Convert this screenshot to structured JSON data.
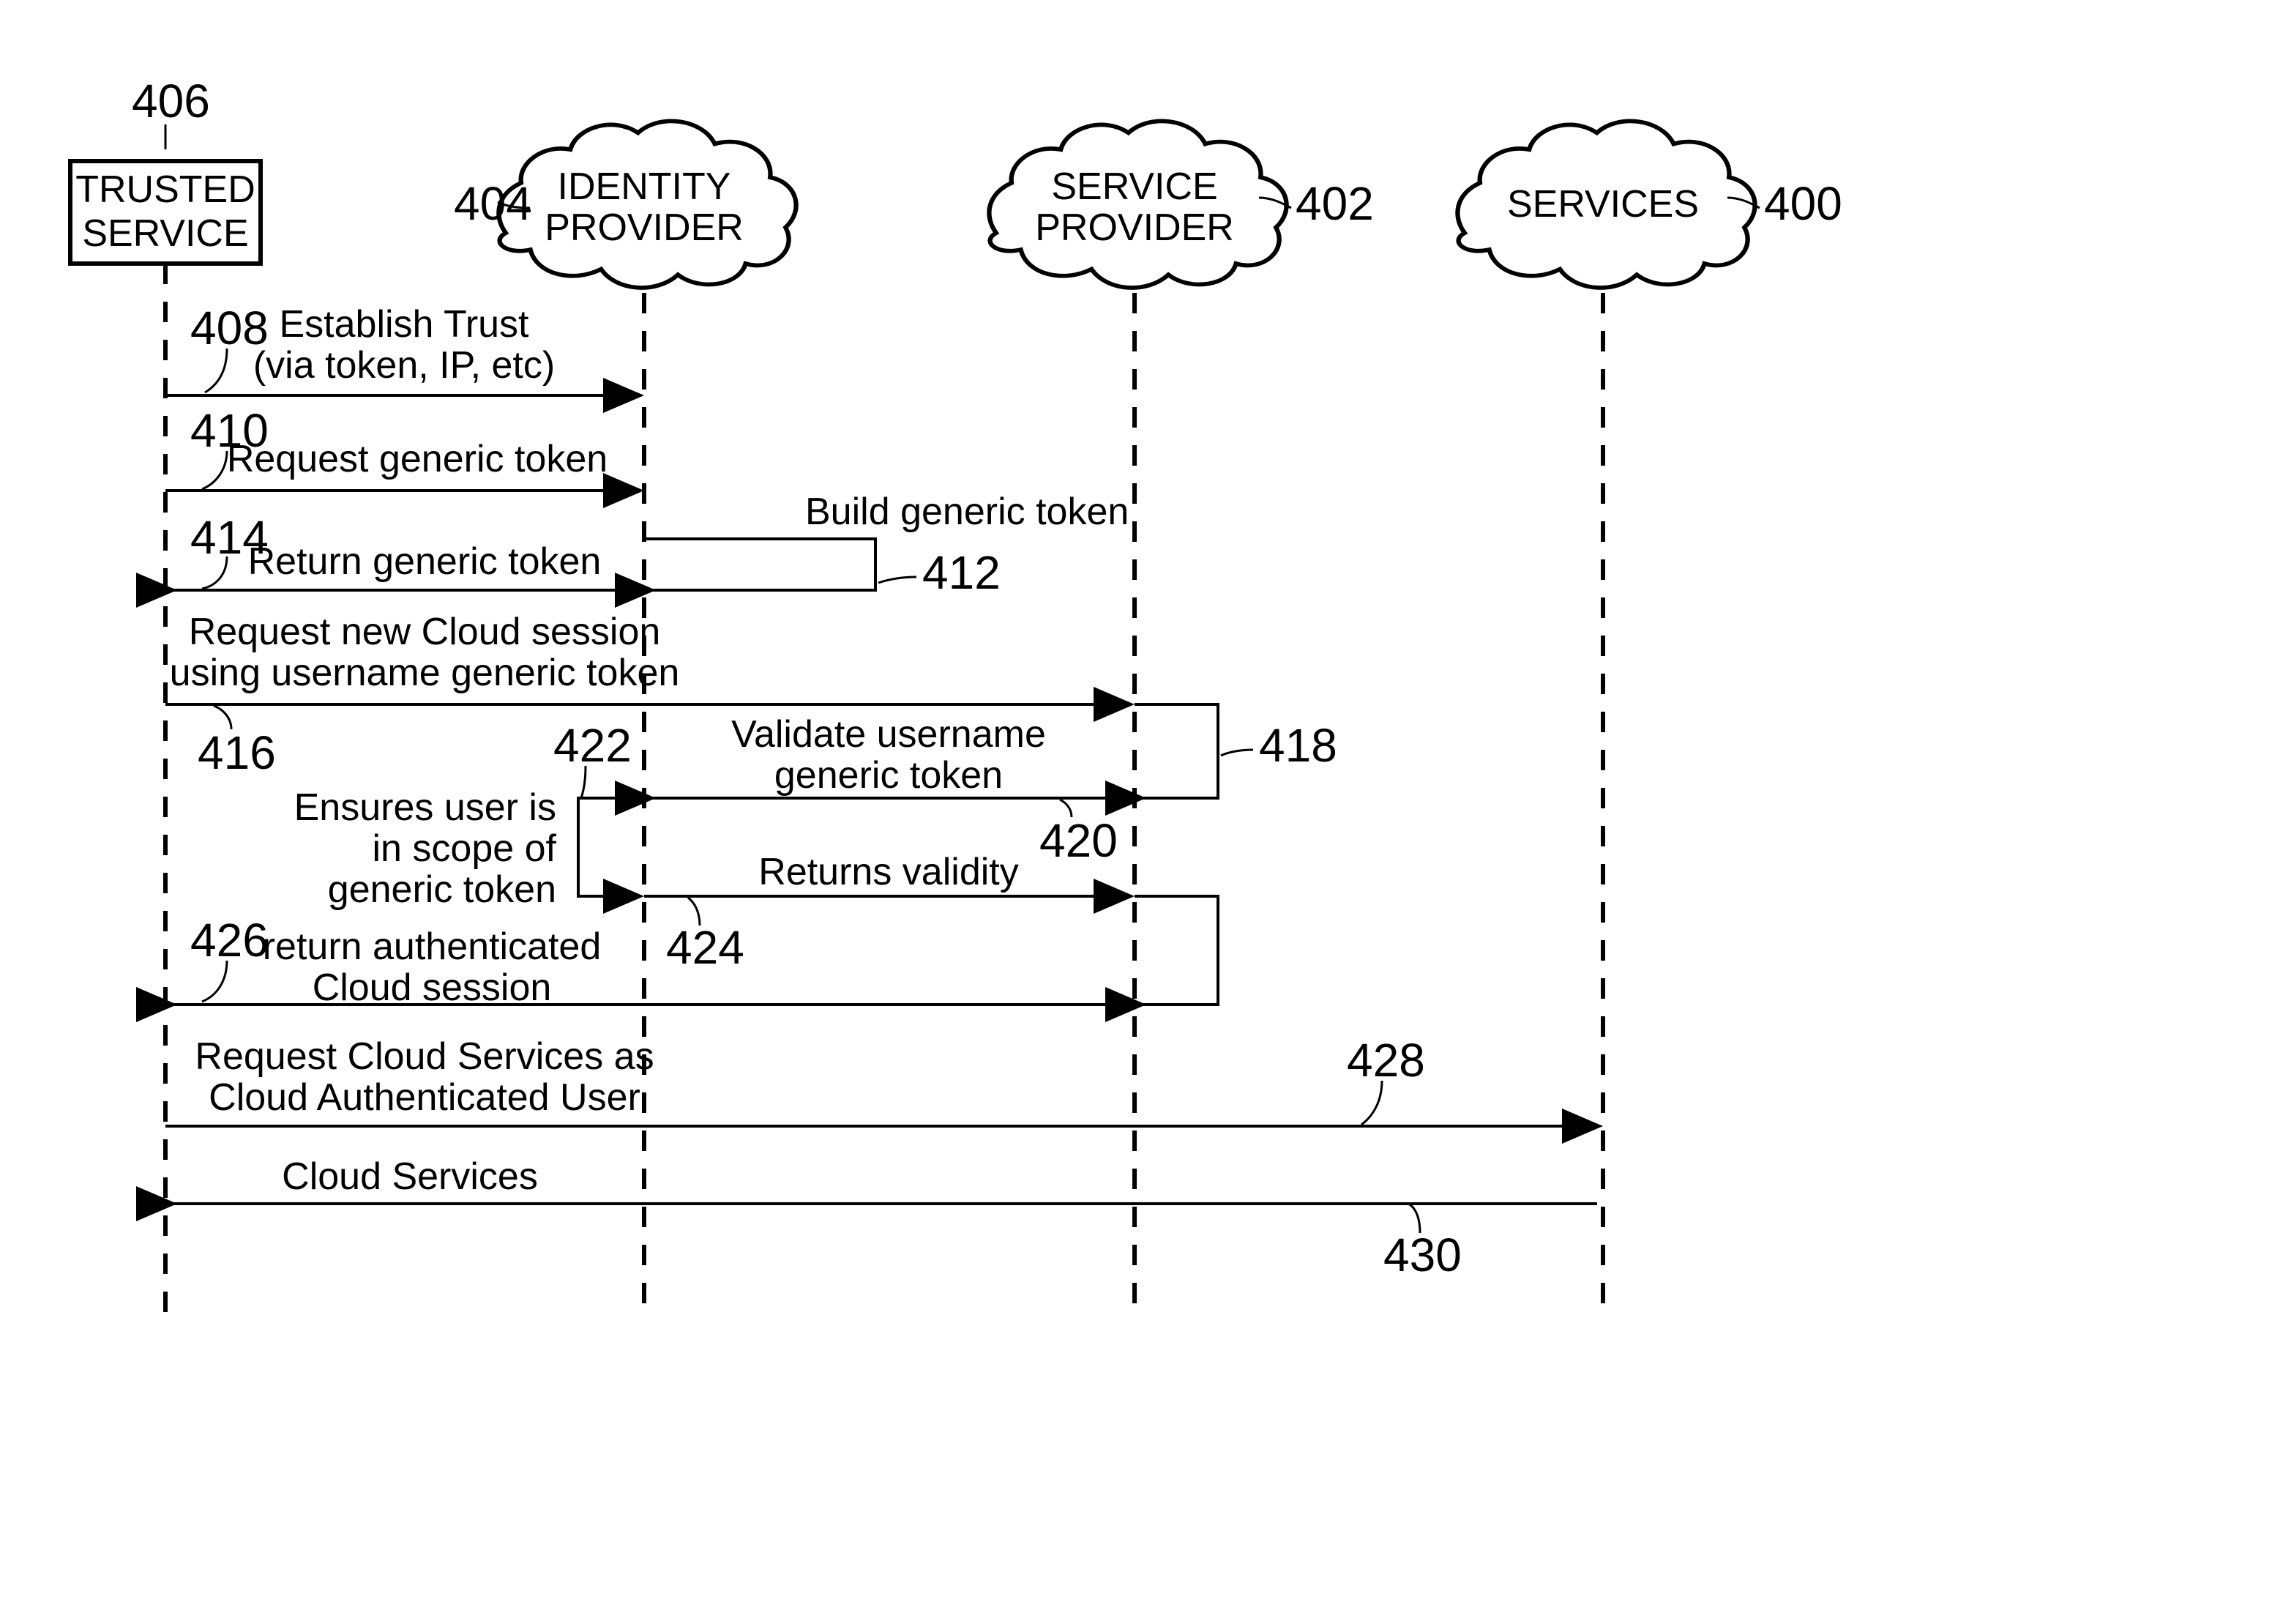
{
  "lanes": {
    "trusted_service": {
      "num": "406",
      "line1": "TRUSTED",
      "line2": "SERVICE"
    },
    "identity_provider": {
      "num": "404",
      "line1": "IDENTITY",
      "line2": "PROVIDER"
    },
    "service_provider": {
      "num": "402",
      "line1": "SERVICE",
      "line2": "PROVIDER"
    },
    "services": {
      "num": "400",
      "line1": "SERVICES"
    }
  },
  "steps": {
    "s408": {
      "num": "408",
      "line1": "Establish Trust",
      "line2": "(via token, IP, etc)"
    },
    "s410": {
      "num": "410",
      "line1": "Request generic token"
    },
    "s412": {
      "num": "412",
      "line1": "Build generic token"
    },
    "s414": {
      "num": "414",
      "line1": "Return generic token"
    },
    "s416": {
      "num": "416",
      "line1": "Request new Cloud session",
      "line2": "using username generic token"
    },
    "s418": {
      "num": "418"
    },
    "s420": {
      "num": "420",
      "line1": "Validate username",
      "line2": "generic token"
    },
    "s422": {
      "num": "422",
      "line1": "Ensures user is",
      "line2": "in scope of",
      "line3": "generic token"
    },
    "s424": {
      "num": "424",
      "line1": "Returns validity"
    },
    "s426": {
      "num": "426",
      "line1": "return authenticated",
      "line2": "Cloud session"
    },
    "s428": {
      "num": "428",
      "line1": "Request Cloud Services as",
      "line2": "Cloud Authenticated User"
    },
    "s430": {
      "num": "430",
      "line1": "Cloud Services"
    }
  }
}
